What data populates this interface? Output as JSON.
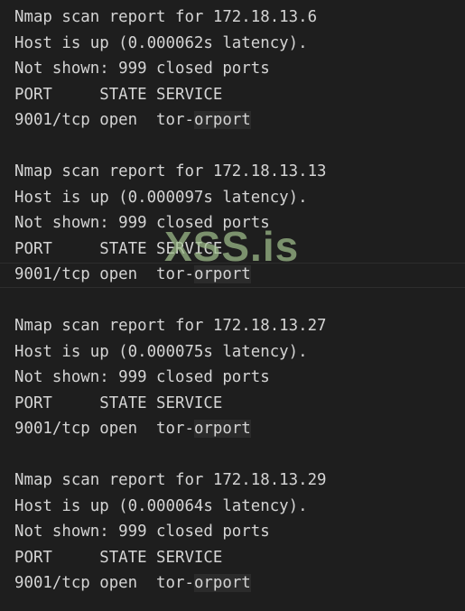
{
  "reports": [
    {
      "header": "Nmap scan report for 172.18.13.6",
      "host": "Host is up (0.000062s latency).",
      "not_shown": "Not shown: 999 closed ports",
      "columns": "PORT     STATE SERVICE",
      "row_prefix": "9001/tcp open  tor-",
      "row_highlight": "orport"
    },
    {
      "header": "Nmap scan report for 172.18.13.13",
      "host": "Host is up (0.000097s latency).",
      "not_shown": "Not shown: 999 closed ports",
      "columns": "PORT     STATE SERVICE",
      "row_prefix": "9001/tcp open  tor-",
      "row_highlight": "orport"
    },
    {
      "header": "Nmap scan report for 172.18.13.27",
      "host": "Host is up (0.000075s latency).",
      "not_shown": "Not shown: 999 closed ports",
      "columns": "PORT     STATE SERVICE",
      "row_prefix": "9001/tcp open  tor-",
      "row_highlight": "orport"
    },
    {
      "header": "Nmap scan report for 172.18.13.29",
      "host": "Host is up (0.000064s latency).",
      "not_shown": "Not shown: 999 closed ports",
      "columns": "PORT     STATE SERVICE",
      "row_prefix": "9001/tcp open  tor-",
      "row_highlight": "orport"
    }
  ],
  "watermark": "XSS.is",
  "colors": {
    "background": "#1e1e1e",
    "text": "#d4d4d4",
    "highlight": "#2b2b2b",
    "watermark": "#a0be8c"
  }
}
